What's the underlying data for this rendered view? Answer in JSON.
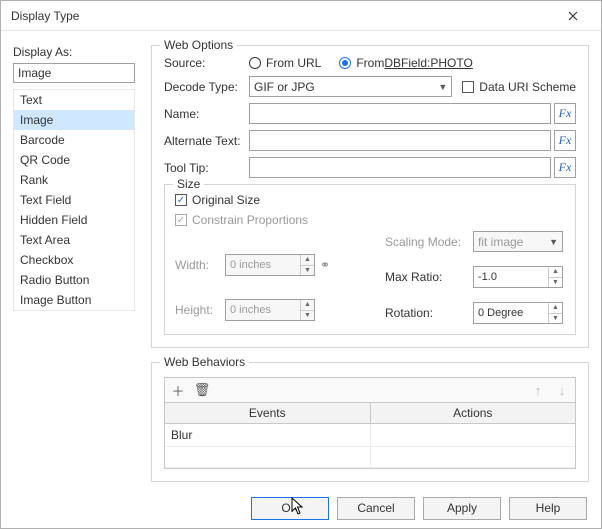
{
  "window": {
    "title": "Display Type"
  },
  "displayAs": {
    "label": "Display As:",
    "value": "Image",
    "items": [
      "Text",
      "Image",
      "Barcode",
      "QR Code",
      "Rank",
      "Text Field",
      "Hidden Field",
      "Text Area",
      "Checkbox",
      "Radio Button",
      "Image Button"
    ],
    "selectedIndex": 1
  },
  "webOptions": {
    "legend": "Web Options",
    "sourceLabel": "Source:",
    "source": {
      "fromUrl": "From URL",
      "fromDbPrefix": "From ",
      "fromDbField": "DBField:PHOTO",
      "selected": "db"
    },
    "decodeLabel": "Decode Type:",
    "decodeValue": "GIF or JPG",
    "dataUriLabel": "Data URI Scheme",
    "dataUriChecked": false,
    "nameLabel": "Name:",
    "nameValue": "",
    "altLabel": "Alternate Text:",
    "altValue": "",
    "tipLabel": "Tool Tip:",
    "tipValue": "",
    "fx": "Fx",
    "size": {
      "legend": "Size",
      "originalLabel": "Original Size",
      "originalChecked": true,
      "constrainLabel": "Constrain Proportions",
      "constrainChecked": true,
      "widthLabel": "Width:",
      "widthValue": "0 inches",
      "heightLabel": "Height:",
      "heightValue": "0 inches",
      "scalingLabel": "Scaling Mode:",
      "scalingValue": "fit image",
      "ratioLabel": "Max Ratio:",
      "ratioValue": "-1.0",
      "rotationLabel": "Rotation:",
      "rotationValue": "0 Degree"
    }
  },
  "webBehaviors": {
    "legend": "Web Behaviors",
    "headEvents": "Events",
    "headActions": "Actions",
    "rows": [
      {
        "event": "Blur",
        "action": ""
      }
    ]
  },
  "buttons": {
    "ok": "OK",
    "cancel": "Cancel",
    "apply": "Apply",
    "help": "Help"
  }
}
